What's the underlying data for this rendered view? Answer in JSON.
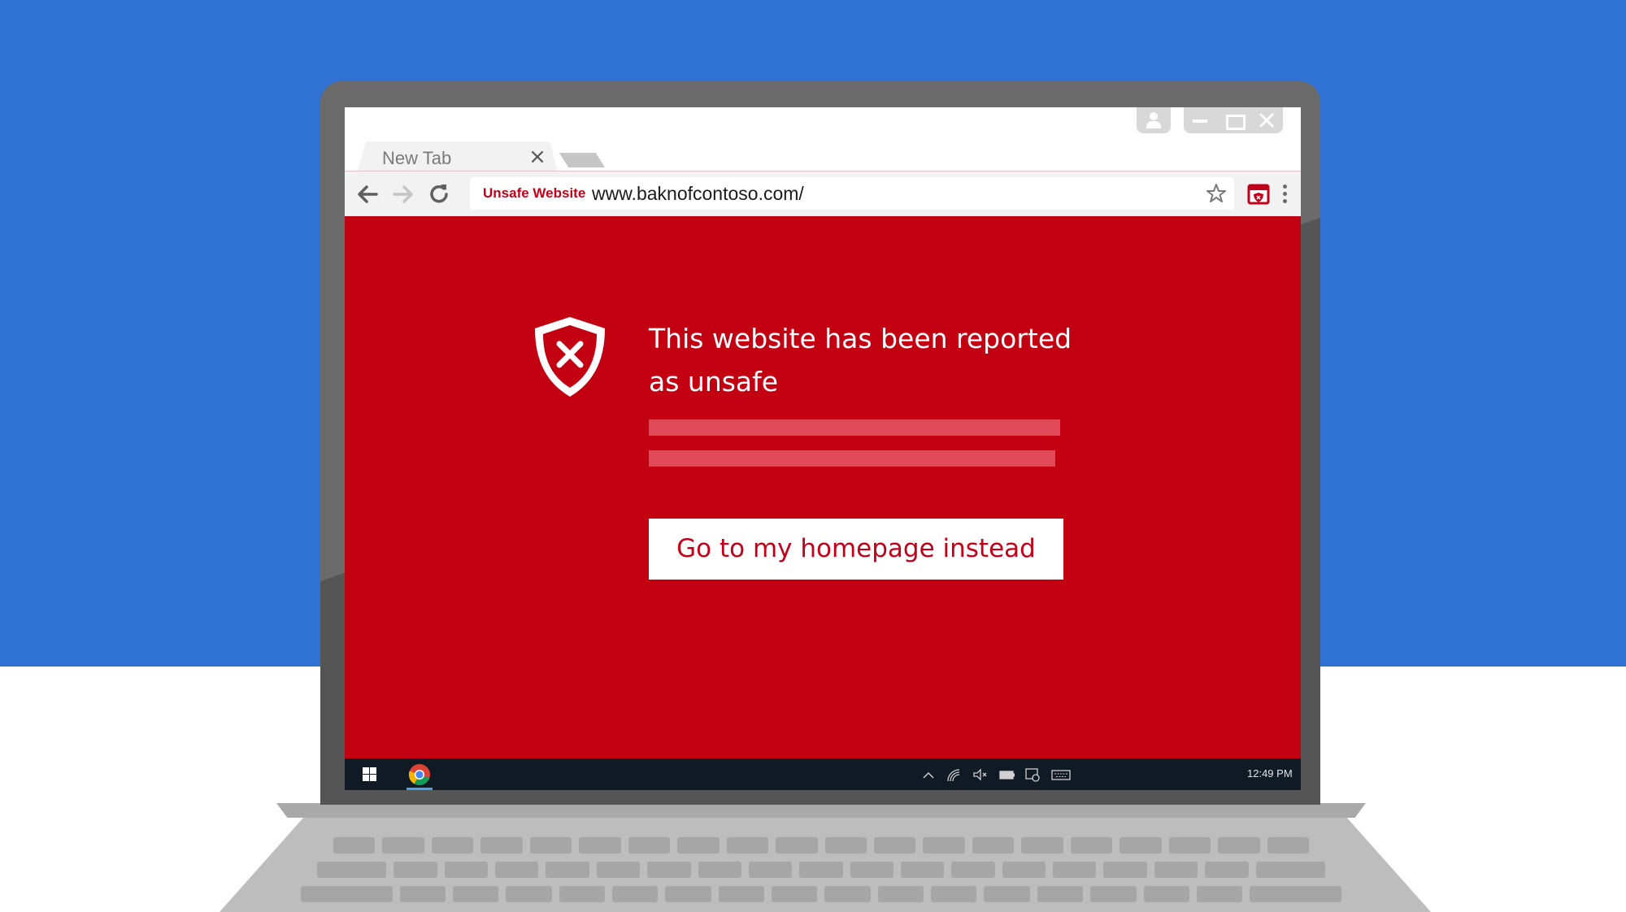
{
  "browser": {
    "tab": {
      "title": "New Tab"
    },
    "address_bar": {
      "security_label": "Unsafe Website",
      "url": "www.baknofcontoso.com/"
    }
  },
  "warning": {
    "title": "This website has been reported as unsafe",
    "home_button_label": "Go to my homepage instead"
  },
  "taskbar": {
    "clock": "12:49 PM"
  },
  "colors": {
    "background_blue": "#3072d3",
    "warning_red": "#c20012",
    "taskbar": "#0f1a24"
  },
  "icons": [
    "user-icon",
    "minimize-icon",
    "maximize-icon",
    "close-icon",
    "back-arrow-icon",
    "forward-arrow-icon",
    "reload-icon",
    "star-icon",
    "extension-shield-icon",
    "menu-dots-icon",
    "shield-x-icon",
    "windows-start-icon",
    "chrome-icon",
    "chevron-up-icon",
    "wifi-icon",
    "volume-muted-icon",
    "battery-icon",
    "action-center-icon",
    "keyboard-icon"
  ]
}
